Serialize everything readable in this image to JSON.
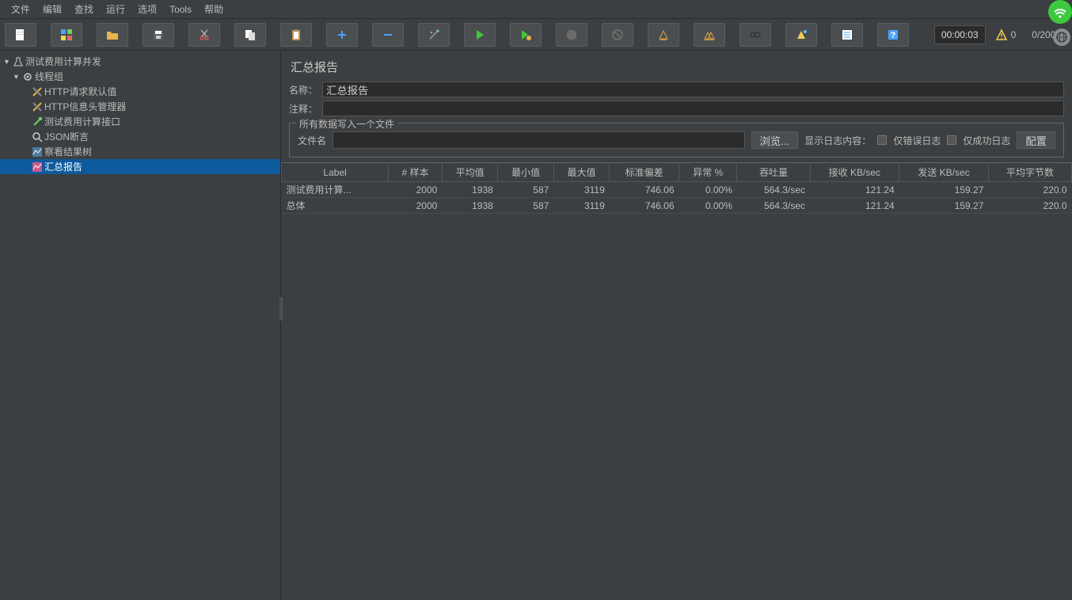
{
  "menu": [
    "文件",
    "编辑",
    "查找",
    "运行",
    "选项",
    "Tools",
    "帮助"
  ],
  "toolbar": {
    "timer": "00:00:03",
    "warn_count": "0",
    "threads": "0/2000"
  },
  "tree": {
    "root": "测试费用计算并发",
    "group": "线程组",
    "items": [
      "HTTP请求默认值",
      "HTTP信息头管理器",
      "测试费用计算接口",
      "JSON断言",
      "察看结果树",
      "汇总报告"
    ]
  },
  "panel": {
    "title": "汇总报告",
    "name_label": "名称：",
    "name_value": "汇总报告",
    "comment_label": "注释：",
    "comment_value": "",
    "fieldset_legend": "所有数据写入一个文件",
    "file_label": "文件名",
    "file_value": "",
    "browse_btn": "浏览...",
    "log_label": "显示日志内容：",
    "only_error": "仅错误日志",
    "only_success": "仅成功日志",
    "config_btn": "配置"
  },
  "table": {
    "headers": [
      "Label",
      "# 样本",
      "平均值",
      "最小值",
      "最大值",
      "标准偏差",
      "异常 %",
      "吞吐量",
      "接收 KB/sec",
      "发送 KB/sec",
      "平均字节数"
    ],
    "rows": [
      [
        "测试费用计算...",
        "2000",
        "1938",
        "587",
        "3119",
        "746.06",
        "0.00%",
        "564.3/sec",
        "121.24",
        "159.27",
        "220.0"
      ],
      [
        "总体",
        "2000",
        "1938",
        "587",
        "3119",
        "746.06",
        "0.00%",
        "564.3/sec",
        "121.24",
        "159.27",
        "220.0"
      ]
    ]
  }
}
